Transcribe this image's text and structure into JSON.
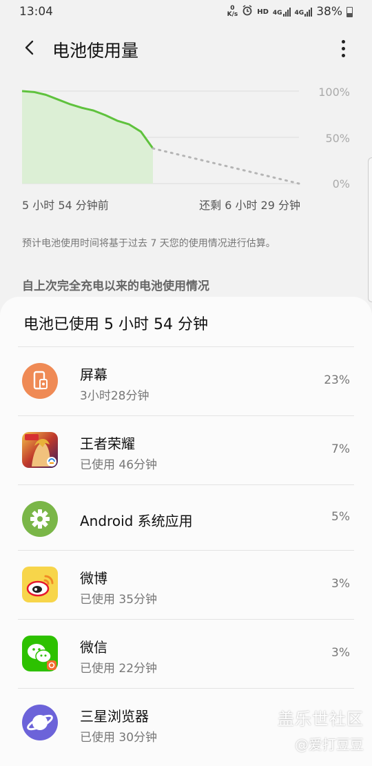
{
  "status": {
    "time": "13:04",
    "speed_top": "0",
    "speed_unit": "K/s",
    "hd": "HD",
    "net1": "4G",
    "net2": "4G",
    "battery": "38%"
  },
  "header": {
    "title": "电池使用量"
  },
  "chart": {
    "y_labels": [
      "100%",
      "50%",
      "0%"
    ],
    "x_start": "5 小时 54 分钟前",
    "x_end": "还剩 6 小时 29 分钟",
    "accent": "#5fc23d"
  },
  "chart_data": {
    "type": "line",
    "title": "",
    "ylabel": "",
    "xlabel": "",
    "ylim": [
      0,
      100
    ],
    "series": [
      {
        "values": [
          100,
          99,
          96,
          91,
          86,
          82,
          79,
          74,
          68,
          64,
          56,
          38
        ]
      },
      {
        "values": [
          38,
          0
        ]
      }
    ]
  },
  "note": "预计电池使用时间将基于过去 7 天您的使用情况进行估算。",
  "section_label": "自上次完全充电以来的电池使用情况",
  "card": {
    "title": "电池已使用 5 小时 54 分钟",
    "items": [
      {
        "name": "屏幕",
        "sub": "3小时28分钟",
        "pct": "23%",
        "icon": "screen-icon"
      },
      {
        "name": "王者荣耀",
        "sub": "已使用 46分钟",
        "pct": "7%",
        "icon": "honor-of-kings-icon"
      },
      {
        "name": "Android 系统应用",
        "sub": "",
        "pct": "5%",
        "icon": "android-system-gear-icon"
      },
      {
        "name": "微博",
        "sub": "已使用 35分钟",
        "pct": "3%",
        "icon": "weibo-icon"
      },
      {
        "name": "微信",
        "sub": "已使用 22分钟",
        "pct": "3%",
        "icon": "wechat-icon"
      },
      {
        "name": "三星浏览器",
        "sub": "已使用 30分钟",
        "pct": "",
        "icon": "samsung-browser-icon"
      }
    ]
  },
  "watermark": {
    "line1": "盖乐世社区",
    "line2": "@爱打豆豆"
  }
}
